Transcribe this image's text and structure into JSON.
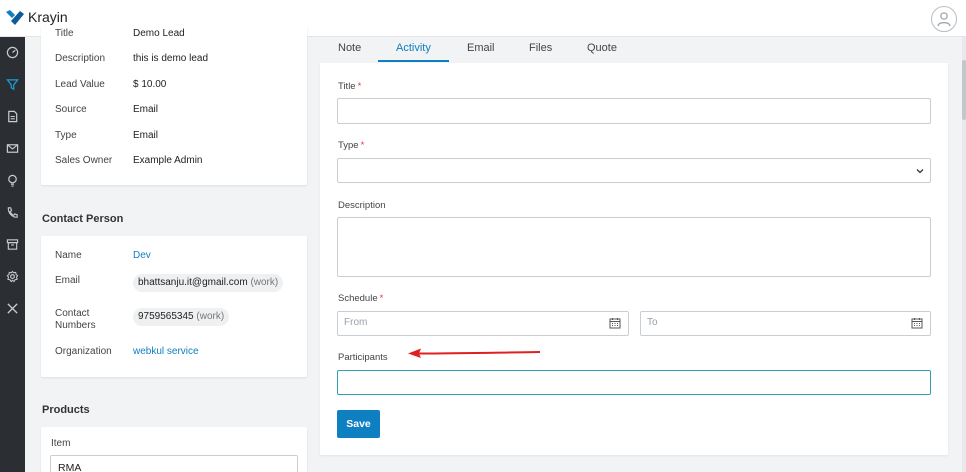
{
  "app": {
    "name": "Krayin"
  },
  "colors": {
    "accent": "#0e7fc1",
    "sidebar": "#2b2f33",
    "required": "#e0393e",
    "annotation": "#e02020"
  },
  "sidebar": {
    "items": [
      {
        "icon": "dashboard-icon"
      },
      {
        "icon": "filter-icon"
      },
      {
        "icon": "document-icon"
      },
      {
        "icon": "mail-icon"
      },
      {
        "icon": "lightbulb-icon"
      },
      {
        "icon": "phone-icon"
      },
      {
        "icon": "archive-icon"
      },
      {
        "icon": "settings-icon"
      },
      {
        "icon": "tools-icon"
      }
    ]
  },
  "lead_details": {
    "title_label": "Title",
    "title_value": "Demo Lead",
    "description_label": "Description",
    "description_value": "this is demo lead",
    "lead_value_label": "Lead Value",
    "lead_value_value": "$ 10.00",
    "source_label": "Source",
    "source_value": "Email",
    "type_label": "Type",
    "type_value": "Email",
    "sales_owner_label": "Sales Owner",
    "sales_owner_value": "Example Admin"
  },
  "contact_person": {
    "heading": "Contact Person",
    "name_label": "Name",
    "name_value": "Dev",
    "email_label": "Email",
    "email_value": "bhattsanju.it@gmail.com",
    "email_type": "(work)",
    "numbers_label_1": "Contact",
    "numbers_label_2": "Numbers",
    "number_value": "9759565345",
    "number_type": "(work)",
    "organization_label": "Organization",
    "organization_value": "webkul service"
  },
  "products": {
    "heading": "Products",
    "item_label": "Item",
    "item_value": "RMA"
  },
  "tabs": [
    {
      "label": "Note"
    },
    {
      "label": "Activity",
      "active": true
    },
    {
      "label": "Email"
    },
    {
      "label": "Files"
    },
    {
      "label": "Quote"
    }
  ],
  "activity_form": {
    "title_label": "Title",
    "type_label": "Type",
    "description_label": "Description",
    "schedule_label": "Schedule",
    "from_placeholder": "From",
    "to_placeholder": "To",
    "participants_label": "Participants",
    "required_mark": "*",
    "save_label": "Save"
  }
}
